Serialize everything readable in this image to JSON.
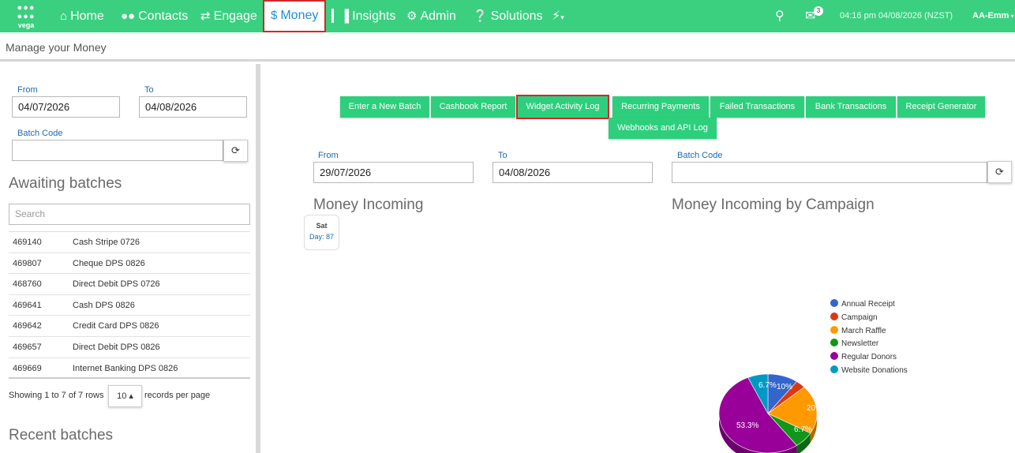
{
  "nav": {
    "logo": "vega",
    "items": [
      {
        "label": "Home",
        "icon": "home-icon",
        "glyph": "⌂"
      },
      {
        "label": "Contacts",
        "icon": "users-icon",
        "glyph": "👥"
      },
      {
        "label": "Engage",
        "icon": "exchange-icon",
        "glyph": "⇄"
      },
      {
        "label": "Money",
        "icon": "dollar-icon",
        "glyph": "$"
      },
      {
        "label": "Insights",
        "icon": "bar-chart-icon",
        "glyph": "▮"
      },
      {
        "label": "Admin",
        "icon": "cogs-icon",
        "glyph": "⚙"
      },
      {
        "label": "Solutions",
        "icon": "question-circle-icon",
        "glyph": "?"
      }
    ],
    "bolt_glyph": "⚡",
    "mail_badge": "3",
    "datetime": "04:16 pm 04/08/2026 (NZST)",
    "user": "AA-Emm"
  },
  "subheader": {
    "title": "Manage your Money"
  },
  "left": {
    "from_label": "From",
    "from_value": "04/07/2026",
    "to_label": "To",
    "to_value": "04/08/2026",
    "batch_code_label": "Batch Code",
    "batch_code_value": "",
    "awaiting_title": "Awaiting batches",
    "search_placeholder": "Search",
    "batches": [
      {
        "id": "469140",
        "name": "Cash Stripe 0726"
      },
      {
        "id": "469807",
        "name": "Cheque DPS 0826"
      },
      {
        "id": "468760",
        "name": "Direct Debit DPS 0726"
      },
      {
        "id": "469641",
        "name": "Cash DPS 0826"
      },
      {
        "id": "469642",
        "name": "Credit Card DPS 0826"
      },
      {
        "id": "469657",
        "name": "Direct Debit DPS 0826"
      },
      {
        "id": "469669",
        "name": "Internet Banking DPS 0826"
      }
    ],
    "showing": "Showing 1 to 7 of 7 rows",
    "per_page_value": "10 ▴",
    "per_page_suffix": "records per page",
    "recent_title": "Recent batches"
  },
  "right": {
    "buttons": [
      "Enter a New Batch",
      "Cashbook Report",
      "Widget Activity Log",
      "Recurring Payments",
      "Failed Transactions",
      "Bank Transactions",
      "Receipt Generator",
      "Webhooks and API Log"
    ],
    "from_label": "From",
    "from_value": "29/07/2026",
    "to_label": "To",
    "to_value": "04/08/2026",
    "batch_code_label": "Batch Code",
    "batch_code_value": "",
    "incoming_title": "Money Incoming",
    "tooltip_day": "Sat",
    "tooltip_value": "Day: 87",
    "campaign_title": "Money Incoming by Campaign"
  },
  "chart_data": {
    "type": "pie",
    "title": "Money Incoming by Campaign",
    "series": [
      {
        "name": "Annual Receipt",
        "value": 10,
        "color": "#3366cc"
      },
      {
        "name": "Campaign",
        "value": 3.3,
        "color": "#dc3912"
      },
      {
        "name": "March Raffle",
        "value": 20,
        "color": "#ff9900"
      },
      {
        "name": "Newsletter",
        "value": 6.7,
        "color": "#109618"
      },
      {
        "name": "Regular Donors",
        "value": 53.3,
        "color": "#990099"
      },
      {
        "name": "Website Donations",
        "value": 6.7,
        "color": "#0099c6"
      }
    ],
    "labels": [
      "6.7%",
      "10%",
      "20",
      "6.7%",
      "53.3%"
    ],
    "legend": "right"
  }
}
